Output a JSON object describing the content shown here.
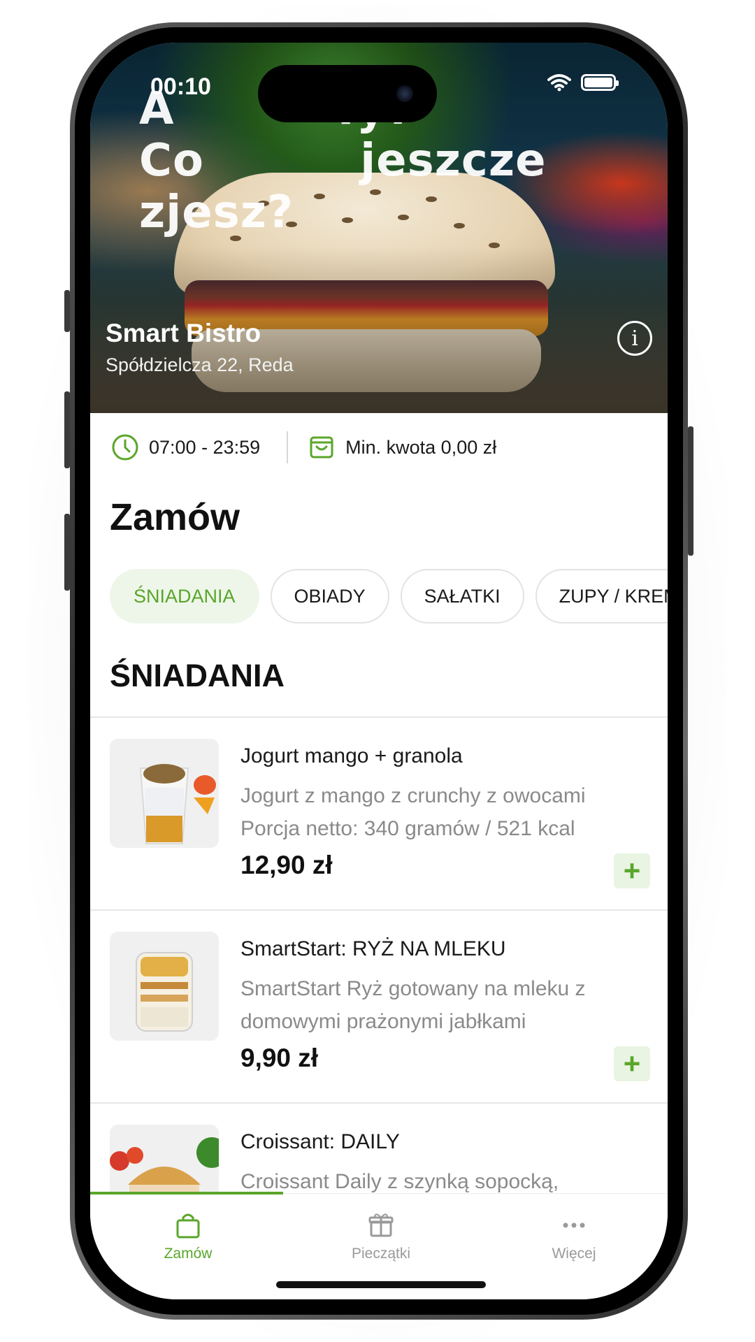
{
  "status_bar": {
    "time": "00:10"
  },
  "hero": {
    "slogan": "A Ty? Co jeszcze zjesz?",
    "restaurant_name": "Smart Bistro",
    "address": "Spółdzielcza 22, Reda"
  },
  "info": {
    "hours": "07:00 - 23:59",
    "min_amount": "Min. kwota 0,00 zł"
  },
  "page_title": "Zamów",
  "categories": [
    "ŚNIADANIA",
    "OBIADY",
    "SAŁATKI",
    "ZUPY / KREMY"
  ],
  "active_category": "ŚNIADANIA",
  "section_title": "ŚNIADANIA",
  "products": [
    {
      "name": "Jogurt mango + granola",
      "description": "Jogurt z mango z crunchy z owocami Porcja netto: 340 gramów / 521 kcal",
      "price": "12,90 zł"
    },
    {
      "name": "SmartStart: RYŻ NA MLEKU",
      "description": "SmartStart Ryż gotowany na mleku z domowymi prażonymi jabłkami",
      "price": "9,90 zł"
    },
    {
      "name": "Croissant: DAILY",
      "description": "Croissant Daily z szynką sopocką, jajkiem, ogórkiem konserwowym i sał...",
      "price": ""
    }
  ],
  "add_symbol": "+",
  "tabbar": {
    "items": [
      {
        "label": "Zamów",
        "icon": "bag-icon"
      },
      {
        "label": "Pieczątki",
        "icon": "gift-icon"
      },
      {
        "label": "Więcej",
        "icon": "more-icon"
      }
    ]
  },
  "colors": {
    "accent": "#5aa62a",
    "accent_bg": "#e9f4e2"
  }
}
